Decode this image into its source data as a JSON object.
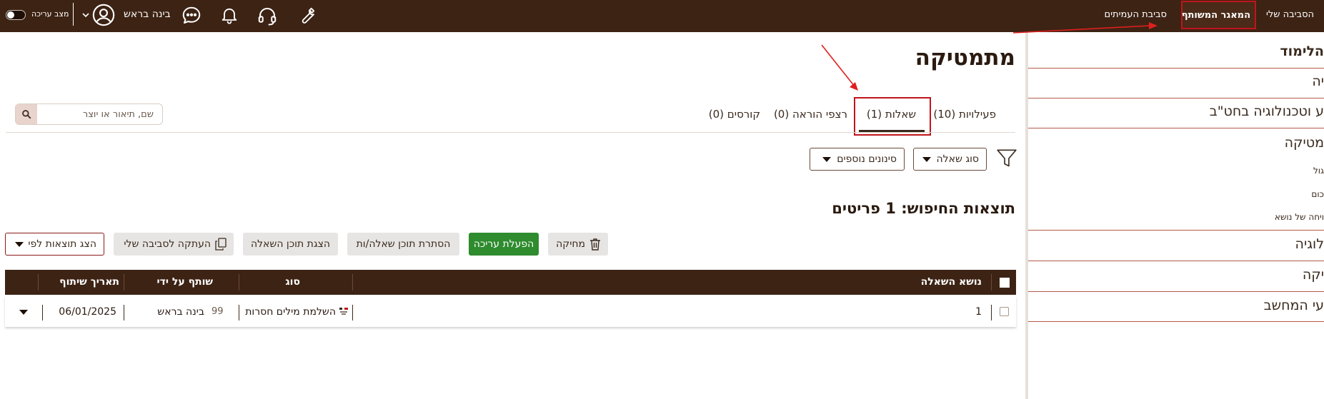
{
  "topbar": {
    "nav_my_env": "הסביבה שלי",
    "nav_shared_repo": "המאגר המשותף",
    "nav_peer_env": "סביבת העמיתים",
    "user_name": "בינה בראש",
    "edit_mode_label": "מצב עריכה",
    "icons": [
      "wrench-icon",
      "headset-icon",
      "bell-icon",
      "chat-icon",
      "user-avatar-icon",
      "chevron-down-icon",
      "toggle-switch"
    ]
  },
  "sidebar": {
    "heading": "הלימוד",
    "items": [
      {
        "label": "יה"
      },
      {
        "label": "ע וטכנולוגיה בחט\"ב"
      },
      {
        "label": "מטיקה"
      },
      {
        "label": "גול"
      },
      {
        "label": "כום"
      },
      {
        "label": "ויחה של נושא"
      },
      {
        "label": "לוגיה"
      },
      {
        "label": "יקה"
      },
      {
        "label": "עי המחשב"
      }
    ]
  },
  "main": {
    "title": "מתמטיקה",
    "tabs": [
      {
        "label": "פעילויות (10)"
      },
      {
        "label": "שאלות (1)"
      },
      {
        "label": "רצפי הוראה (0)"
      },
      {
        "label": "קורסים (0)"
      }
    ],
    "search_placeholder": "שם, תיאור או יוצר",
    "filters": {
      "question_type": "סוג שאלה",
      "more_filters": "סינונים נוספים"
    },
    "results_heading": "תוצאות החיפוש: 1 פריטים",
    "actions": {
      "delete": "מחיקה",
      "enable_edit": "הפעלת עריכה",
      "hide_content": "הסתרת תוכן שאלה/ות",
      "show_content": "הצגת תוכן השאלה",
      "copy_to_env": "העתקה לסביבה שלי",
      "show_results_by": "הצג תוצאות לפי"
    },
    "table": {
      "headers": {
        "topic": "נושא השאלה",
        "type": "סוג",
        "shared_by": "שותף על ידי",
        "share_date": "תאריך שיתוף"
      },
      "rows": [
        {
          "topic": "1",
          "type": "השלמת מילים חסרות",
          "shared_by": "בינה בראש",
          "shared_by_badge": "99",
          "share_date": "06/01/2025"
        }
      ]
    }
  },
  "colors": {
    "topbar_bg": "#3d2314",
    "table_header_bg": "#3d2314",
    "accent_green": "#2e8b2e",
    "highlight_red": "#c0141c",
    "divider": "#b65a4a"
  }
}
